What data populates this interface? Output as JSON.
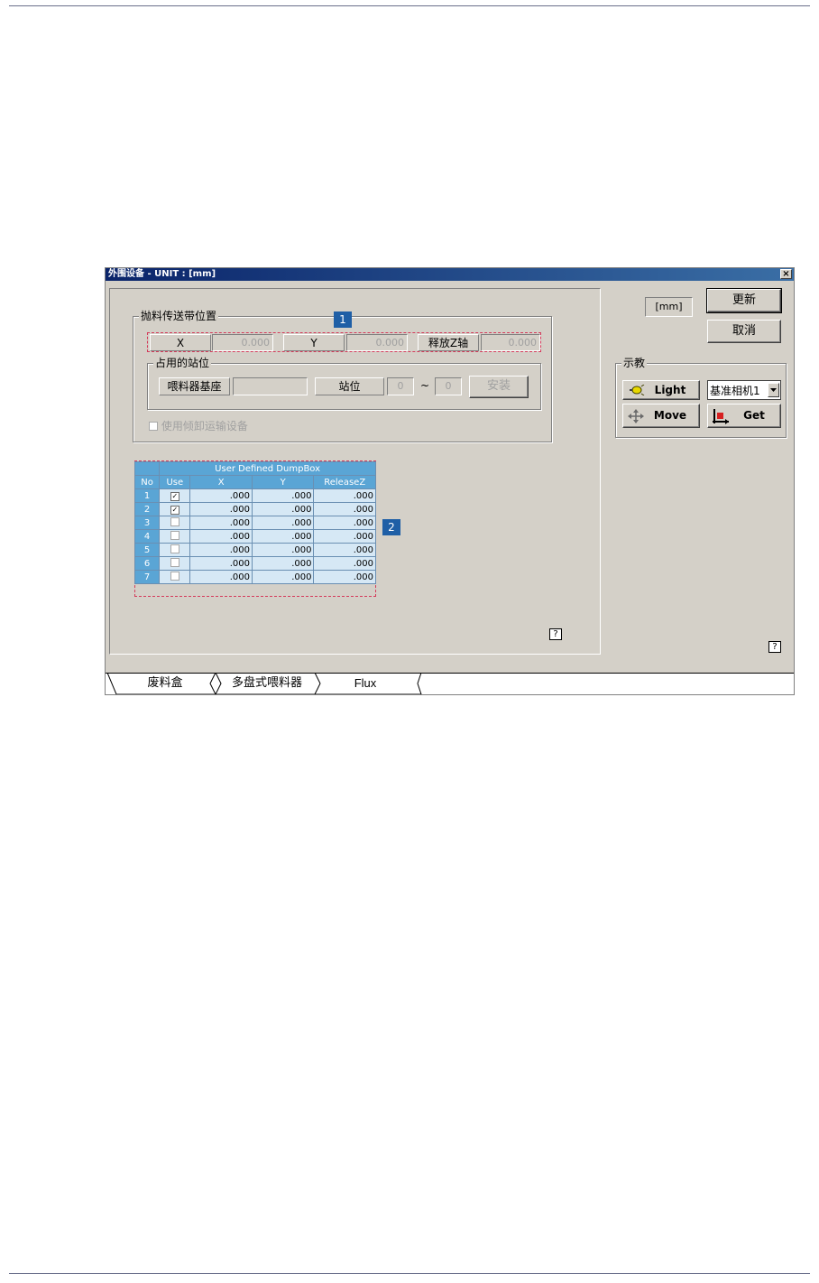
{
  "window": {
    "title": "外围设备 - UNIT : [mm]",
    "close_glyph": "×"
  },
  "conveyor_group": {
    "legend": "抛料传送带位置",
    "x_label": "X",
    "x_value": "0.000",
    "y_label": "Y",
    "y_value": "0.000",
    "z_label": "释放Z轴",
    "z_value": "0.000"
  },
  "occupied_group": {
    "legend": "占用的站位",
    "base_label": "喂料器基座",
    "base_value": "",
    "station_label": "站位",
    "station_from": "0",
    "station_sep": "~",
    "station_to": "0",
    "install_button": "安装"
  },
  "discharge_checkbox": {
    "label": "使用倾卸运输设备",
    "checked": false
  },
  "badges": {
    "one": "1",
    "two": "2"
  },
  "dumpbox_table": {
    "title": "User Defined DumpBox",
    "columns": [
      "No",
      "Use",
      "X",
      "Y",
      "ReleaseZ"
    ],
    "rows": [
      {
        "no": "1",
        "use": true,
        "x": ".000",
        "y": ".000",
        "z": ".000"
      },
      {
        "no": "2",
        "use": true,
        "x": ".000",
        "y": ".000",
        "z": ".000"
      },
      {
        "no": "3",
        "use": false,
        "x": ".000",
        "y": ".000",
        "z": ".000"
      },
      {
        "no": "4",
        "use": false,
        "x": ".000",
        "y": ".000",
        "z": ".000"
      },
      {
        "no": "5",
        "use": false,
        "x": ".000",
        "y": ".000",
        "z": ".000"
      },
      {
        "no": "6",
        "use": false,
        "x": ".000",
        "y": ".000",
        "z": ".000"
      },
      {
        "no": "7",
        "use": false,
        "x": ".000",
        "y": ".000",
        "z": ".000"
      }
    ]
  },
  "right_panel": {
    "unit_label": "[mm]",
    "update_button": "更新",
    "cancel_button": "取消",
    "teach_legend": "示教",
    "light_button": "Light",
    "move_button": "Move",
    "get_button": "Get",
    "camera_select": "基准相机1"
  },
  "help_glyph": "?",
  "tabs": [
    {
      "label": "废料盒",
      "active": true
    },
    {
      "label": "多盘式喂料器",
      "active": false
    },
    {
      "label": "Flux",
      "active": false
    }
  ]
}
